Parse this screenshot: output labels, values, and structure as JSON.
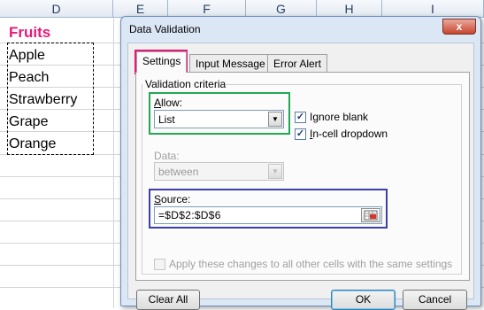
{
  "sheet": {
    "columns": [
      "D",
      "E",
      "F",
      "G",
      "H",
      "I"
    ],
    "header_cell": "Fruits",
    "cells": [
      "Apple",
      "Peach",
      "Strawberry",
      "Grape",
      "Orange"
    ],
    "accent_color": "#e6197a"
  },
  "dialog": {
    "title": "Data Validation",
    "close_glyph": "x",
    "tabs": [
      "Settings",
      "Input Message",
      "Error Alert"
    ],
    "active_tab": "Settings",
    "validation_criteria_label": "Validation criteria",
    "allow": {
      "label_accel": "A",
      "label_rest": "llow:",
      "value": "List"
    },
    "ignore_blank": {
      "label": "Ignore blank",
      "accel": "b",
      "checked": true
    },
    "in_cell_dropdown": {
      "label_accel": "I",
      "label_rest": "n-cell dropdown",
      "checked": true
    },
    "data": {
      "label": "Data:",
      "value": "between",
      "disabled": true
    },
    "source": {
      "label_accel": "S",
      "label_rest": "ource:",
      "value": "=$D$2:$D$6"
    },
    "apply_all": {
      "label": "Apply these changes to all other cells with the same settings",
      "checked": false,
      "disabled": true
    },
    "buttons": {
      "clear_all": "Clear All",
      "ok": "OK",
      "cancel": "Cancel"
    }
  },
  "highlight_colors": {
    "settings_tab": "#e6197a",
    "allow_box": "#22a854",
    "source_box": "#3b3fa6"
  }
}
